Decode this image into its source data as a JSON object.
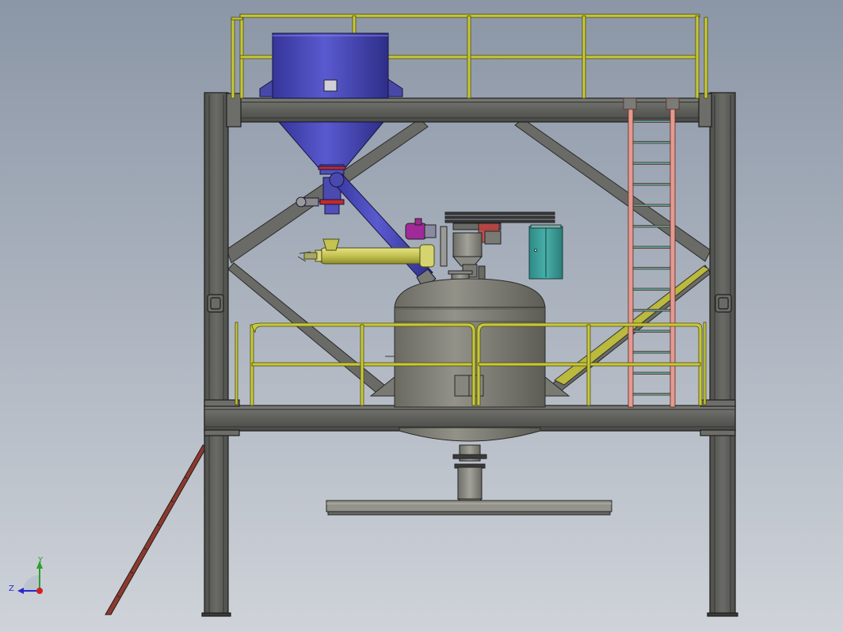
{
  "viewport": {
    "background_top": "#8b96a6",
    "background_bottom": "#cfd3d9"
  },
  "model": {
    "steel_color": "#5f605c",
    "handrail_color": "#c8c83a",
    "ladder_color": "#e59a90",
    "hopper_color": "#4a4ab0",
    "screw_conveyor_color": "#c9c85a",
    "tank_color": "#808078",
    "cabinet_color": "#3a9a96",
    "motor_color": "#a02a9a",
    "stair_color": "#8a3a30"
  },
  "triad": {
    "y_label": "Y",
    "z_label": "Z",
    "y_color": "#2aa02a",
    "z_color": "#2a2ad0",
    "origin_color": "#d02020"
  }
}
